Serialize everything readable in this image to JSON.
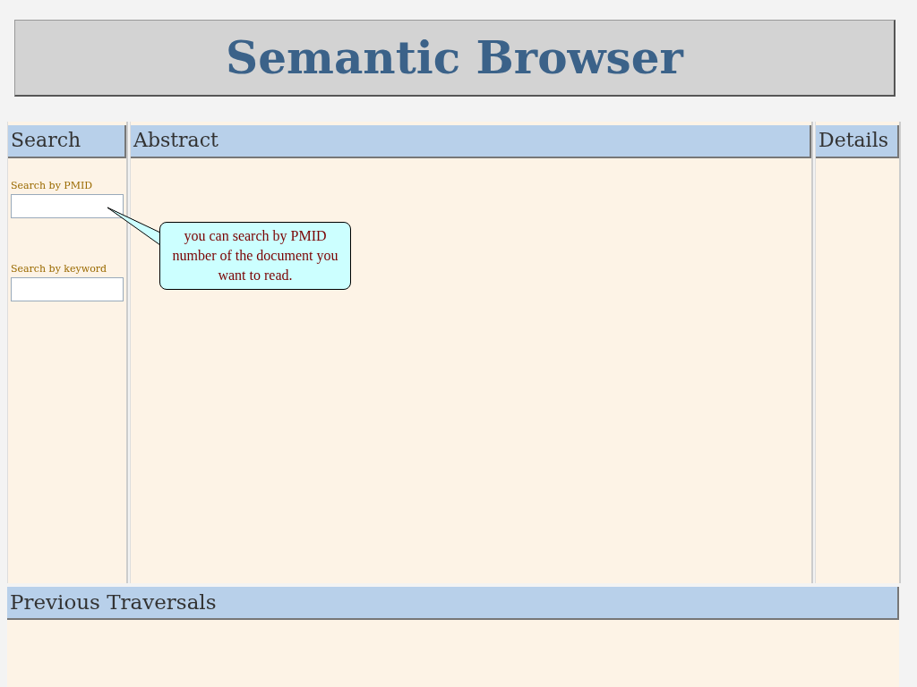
{
  "header": {
    "title": "Semantic Browser"
  },
  "search_panel": {
    "heading": "Search",
    "fields": [
      {
        "label": "Search by PMID"
      },
      {
        "label": "Search by keyword"
      }
    ]
  },
  "abstract_panel": {
    "heading": "Abstract"
  },
  "details_panel": {
    "heading": "Details"
  },
  "traversals_panel": {
    "heading": "Previous Traversals"
  },
  "callout": {
    "text": "you can search by PMID number of the document you want to read."
  }
}
